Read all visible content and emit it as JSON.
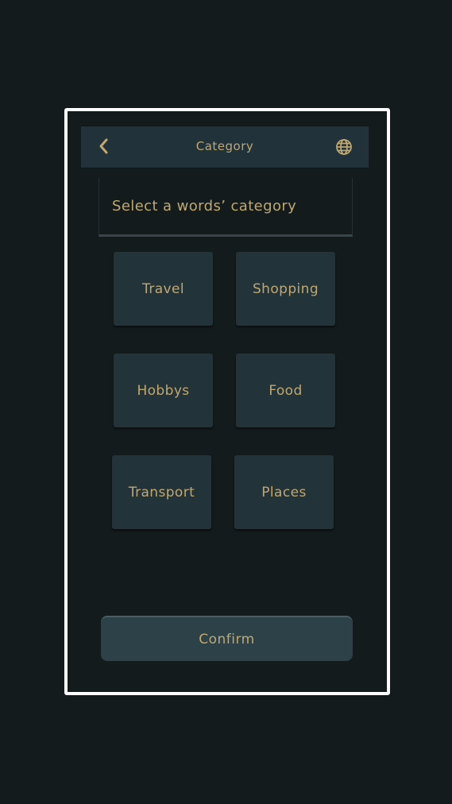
{
  "header": {
    "title": "Category",
    "back_icon": "chevron-left-icon",
    "language_icon": "globe-icon"
  },
  "prompt": "Select a words’ category",
  "categories": [
    "Travel",
    "Shopping",
    "Hobbys",
    "Food",
    "Transport",
    "Places"
  ],
  "confirm_label": "Confirm",
  "colors": {
    "background": "#131b1d",
    "header": "#21323a",
    "tile": "#22333a",
    "button": "#2c4148",
    "text": "#c0a870",
    "frame": "#ffffff"
  }
}
